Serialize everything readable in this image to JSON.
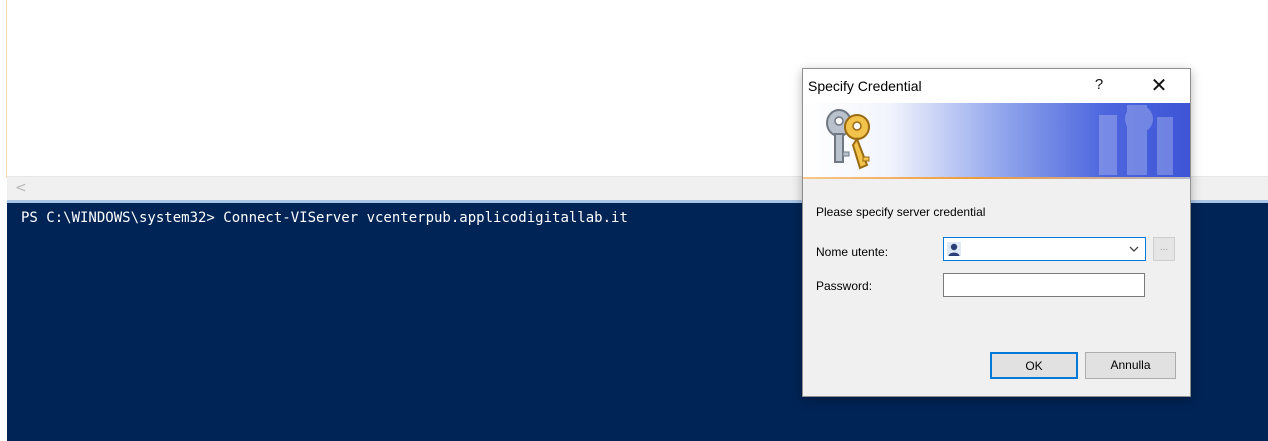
{
  "console": {
    "command_line": "PS C:\\WINDOWS\\system32> Connect-VIServer vcenterpub.applicodigitallab.it"
  },
  "dialog": {
    "title": "Specify Credential",
    "help_label": "?",
    "close_label": "✕",
    "prompt": "Please specify server credential",
    "username_label": "Nome utente:",
    "username_value": "",
    "browse_label": "...",
    "password_label": "Password:",
    "password_value": "",
    "ok_label": "OK",
    "cancel_label": "Annulla"
  },
  "icons": {
    "banner": "keys-icon",
    "user": "user-avatar-icon",
    "dropdown": "chevron-down-icon",
    "scroll": "scroll-left-arrow-icon"
  },
  "colors": {
    "console_bg": "#012456",
    "accent": "#0078d7",
    "dialog_bg": "#f0f0f0"
  }
}
